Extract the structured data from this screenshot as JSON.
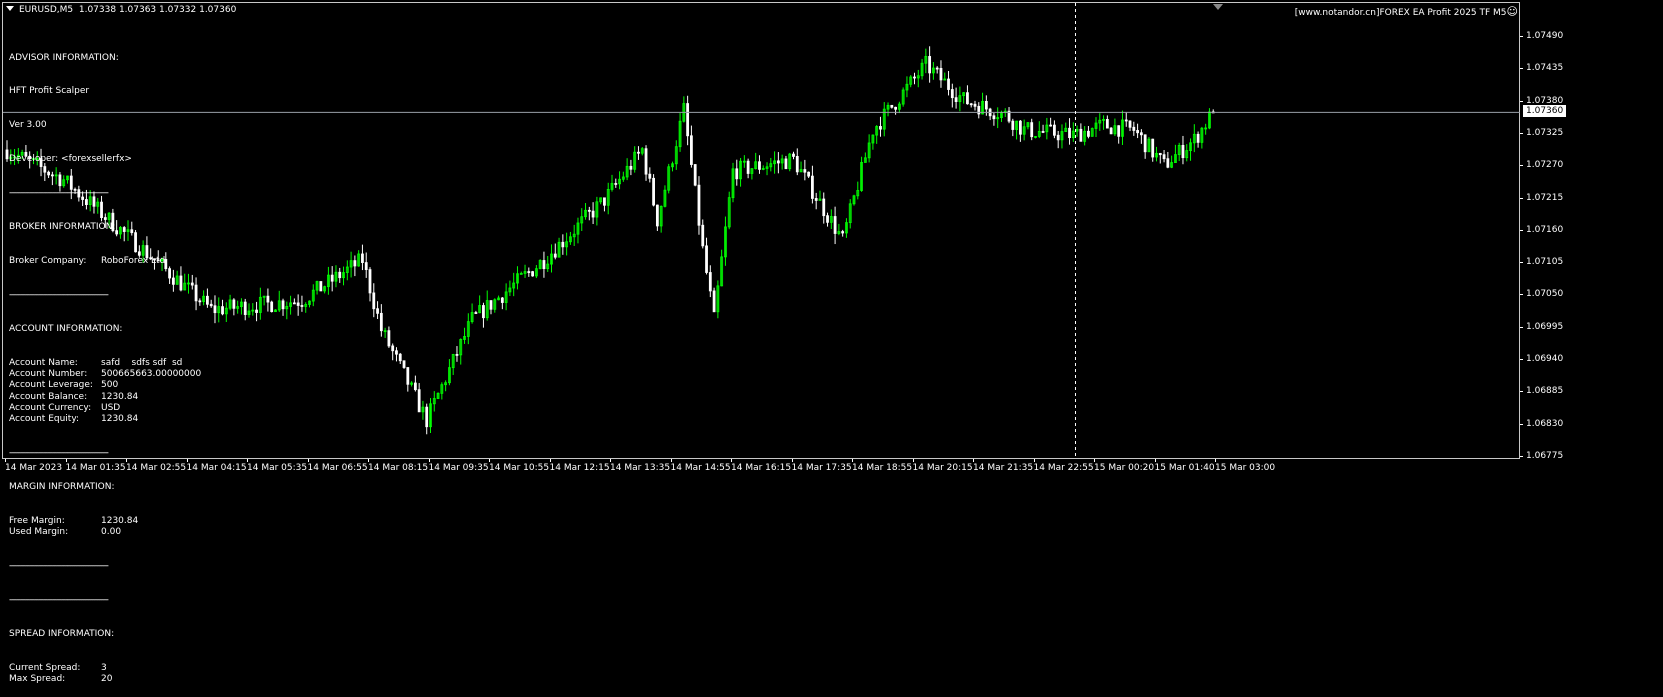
{
  "header": {
    "symbol": "EURUSD,M5",
    "ohlc": "1.07338 1.07363 1.07332 1.07360",
    "brand": "[www.notandor.cn]FOREX EA Profit 2025 TF M5",
    "smile": "☺"
  },
  "info": {
    "advisor_title": "ADVISOR INFORMATION:",
    "advisor_name": "HFT Profit Scalper",
    "version": "Ver 3.00",
    "developer": "Developer: <forexsellerfx>",
    "sep": "--------------------------------------------",
    "broker_title": "BROKER INFORMATION:",
    "broker_label": "Broker Company:",
    "broker_value": "RoboForex Ltd",
    "account_title": "ACCOUNT INFORMATION:",
    "account_rows": [
      {
        "k": "Account Name:",
        "v": "safd    sdfs sdf  sd"
      },
      {
        "k": "Account Number:",
        "v": "500665663.00000000"
      },
      {
        "k": "Account Leverage:",
        "v": "500"
      },
      {
        "k": "Account Balance:",
        "v": "1230.84"
      },
      {
        "k": "Account Currency:",
        "v": "USD"
      },
      {
        "k": "Account Equity:",
        "v": "1230.84"
      }
    ],
    "margin_title": "MARGIN INFORMATION:",
    "margin_rows": [
      {
        "k": "Free Margin:",
        "v": "1230.84"
      },
      {
        "k": "Used Margin:",
        "v": "0.00"
      }
    ],
    "spread_title": "SPREAD INFORMATION:",
    "spread_rows": [
      {
        "k": "Current Spread:",
        "v": "3"
      },
      {
        "k": "Max Spread:",
        "v": "20"
      }
    ]
  },
  "colors": {
    "bull": "#00ff00",
    "bear": "#ffffff",
    "bg": "#000000",
    "grid": "#c8c8c8"
  },
  "chart_data": {
    "type": "candlestick",
    "symbol": "EURUSD",
    "timeframe": "M5",
    "current_price": "1.07360",
    "ylim": [
      1.06775,
      1.0749
    ],
    "price_labels": [
      "1.07490",
      "1.07435",
      "1.07380",
      "1.07325",
      "1.07270",
      "1.07215",
      "1.07160",
      "1.07105",
      "1.07050",
      "1.06995",
      "1.06940",
      "1.06885",
      "1.06830",
      "1.06775"
    ],
    "time_labels": [
      "14 Mar 2023",
      "14 Mar 01:35",
      "14 Mar 02:55",
      "14 Mar 04:15",
      "14 Mar 05:35",
      "14 Mar 06:55",
      "14 Mar 08:15",
      "14 Mar 09:35",
      "14 Mar 10:55",
      "14 Mar 12:15",
      "14 Mar 13:35",
      "14 Mar 14:55",
      "14 Mar 16:15",
      "14 Mar 17:35",
      "14 Mar 18:55",
      "14 Mar 20:15",
      "14 Mar 21:35",
      "14 Mar 22:55",
      "15 Mar 00:20",
      "15 Mar 01:40",
      "15 Mar 03:00"
    ],
    "bars_per_label": 16,
    "path_bar_price": [
      [
        0,
        1.07296
      ],
      [
        15,
        1.07245
      ],
      [
        36,
        1.07126
      ],
      [
        54,
        1.07024
      ],
      [
        78,
        1.0704
      ],
      [
        94,
        1.07109
      ],
      [
        99,
        1.0699
      ],
      [
        111,
        1.06836
      ],
      [
        123,
        1.07007
      ],
      [
        142,
        1.07109
      ],
      [
        158,
        1.07211
      ],
      [
        168,
        1.07296
      ],
      [
        172,
        1.07177
      ],
      [
        179,
        1.07364
      ],
      [
        184,
        1.07126
      ],
      [
        187,
        1.07007
      ],
      [
        192,
        1.0726
      ],
      [
        208,
        1.0728
      ],
      [
        221,
        1.07143
      ],
      [
        229,
        1.0733
      ],
      [
        243,
        1.07441
      ],
      [
        253,
        1.07381
      ],
      [
        264,
        1.07356
      ],
      [
        269,
        1.0733
      ],
      [
        282,
        1.07321
      ],
      [
        290,
        1.07338
      ],
      [
        298,
        1.0733
      ],
      [
        306,
        1.0727
      ],
      [
        314,
        1.07313
      ],
      [
        319,
        1.0736
      ]
    ]
  }
}
